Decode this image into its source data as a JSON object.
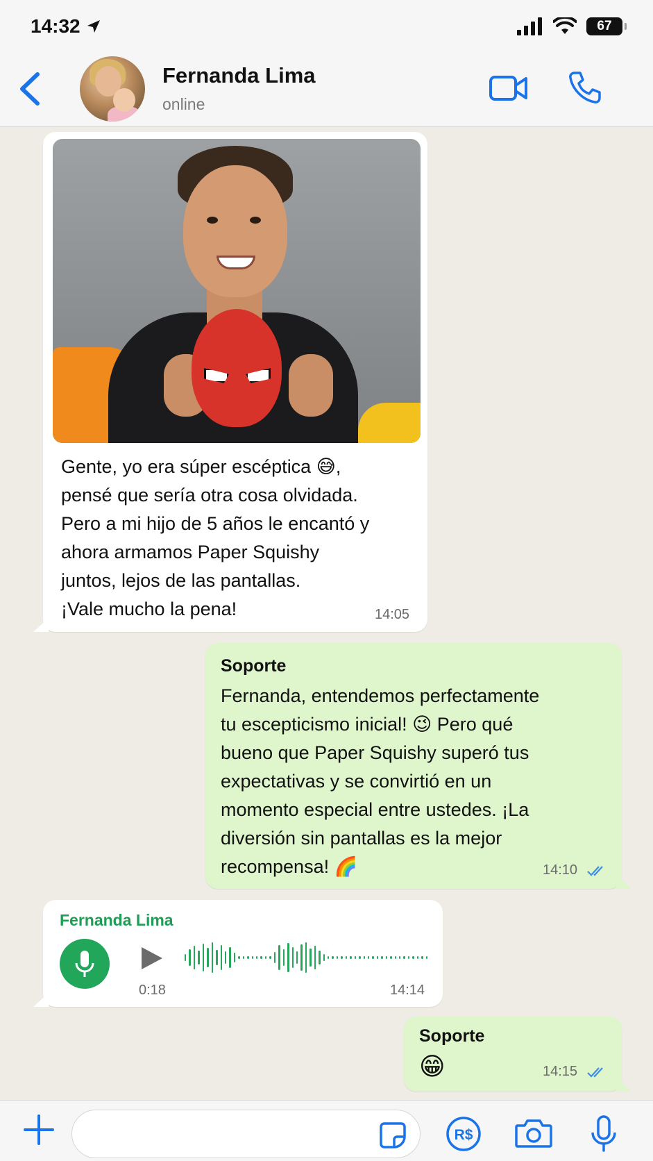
{
  "status_bar": {
    "time": "14:32",
    "battery": "67"
  },
  "header": {
    "contact_name": "Fernanda Lima",
    "contact_status": "online"
  },
  "messages": [
    {
      "direction": "incoming",
      "type": "image",
      "caption_lines": [
        "Gente, yo era súper escéptica 😅,",
        "pensé que sería otra cosa olvidada.",
        "Pero a mi hijo de 5 años le encantó y",
        "ahora armamos Paper Squishy",
        "juntos, lejos de las pantallas.",
        "¡Vale mucho la pena!"
      ],
      "time": "14:05"
    },
    {
      "direction": "outgoing",
      "sender": "Soporte",
      "lines": [
        "Fernanda, entendemos perfectamente",
        "tu escepticismo inicial! 😉 Pero qué",
        "bueno que Paper Squishy superó tus",
        "expectativas y se convirtió en un",
        "momento especial entre ustedes. ¡La",
        "diversión sin pantallas es la mejor",
        "recompensa! 🌈"
      ],
      "time": "14:10"
    },
    {
      "direction": "incoming",
      "type": "voice",
      "sender": "Fernanda Lima",
      "duration": "0:18",
      "time": "14:14"
    },
    {
      "direction": "outgoing",
      "sender": "Soporte",
      "text": "😁",
      "time": "14:15"
    }
  ],
  "input": {
    "placeholder": ""
  },
  "colors": {
    "accent_blue": "#1a73e8",
    "wa_green": "#21a65a",
    "outgoing_bubble": "#dff6cc",
    "incoming_bubble": "#ffffff",
    "chat_bg": "#efebe5"
  },
  "icons": {
    "back": "chevron-left-icon",
    "video": "video-camera-icon",
    "call": "phone-icon",
    "plus": "plus-icon",
    "sticker": "sticker-icon",
    "pay": "pix-payment-icon",
    "camera": "camera-icon",
    "mic": "microphone-icon"
  }
}
